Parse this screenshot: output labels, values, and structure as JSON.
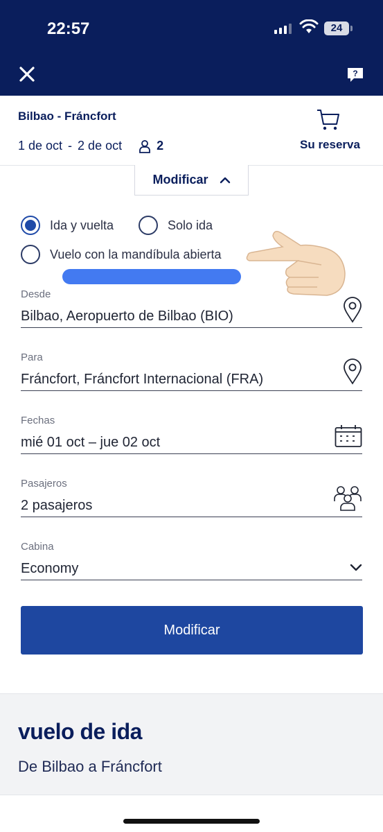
{
  "status": {
    "time": "22:57",
    "battery": "24"
  },
  "header": {
    "close_icon": "close-icon",
    "help_icon": "help-icon"
  },
  "summary": {
    "route": "Bilbao - Fráncfort",
    "date_out": "1 de oct",
    "separator": "-",
    "date_back": "2 de oct",
    "passengers": "2",
    "cart_label": "Su reserva"
  },
  "modify_toggle": {
    "label": "Modificar"
  },
  "trip_type": {
    "options": [
      {
        "label": "Ida y vuelta",
        "selected": true
      },
      {
        "label": "Solo ida",
        "selected": false
      },
      {
        "label": "Vuelo con la mandíbula abierta",
        "selected": false
      }
    ]
  },
  "form": {
    "from": {
      "label": "Desde",
      "value": "Bilbao, Aeropuerto de Bilbao (BIO)"
    },
    "to": {
      "label": "Para",
      "value": "Fráncfort, Fráncfort Internacional (FRA)"
    },
    "dates": {
      "label": "Fechas",
      "value": "mié 01 oct – jue 02 oct"
    },
    "passengers": {
      "label": "Pasajeros",
      "value": "2 pasajeros"
    },
    "cabin": {
      "label": "Cabina",
      "value": "Economy"
    },
    "submit_label": "Modificar"
  },
  "outbound": {
    "title": "vuelo de ida",
    "subtitle": "De Bilbao a Fráncfort"
  },
  "colors": {
    "navy": "#0a1e5c",
    "primary": "#1e47a0",
    "annotation": "#2f6cf0"
  }
}
